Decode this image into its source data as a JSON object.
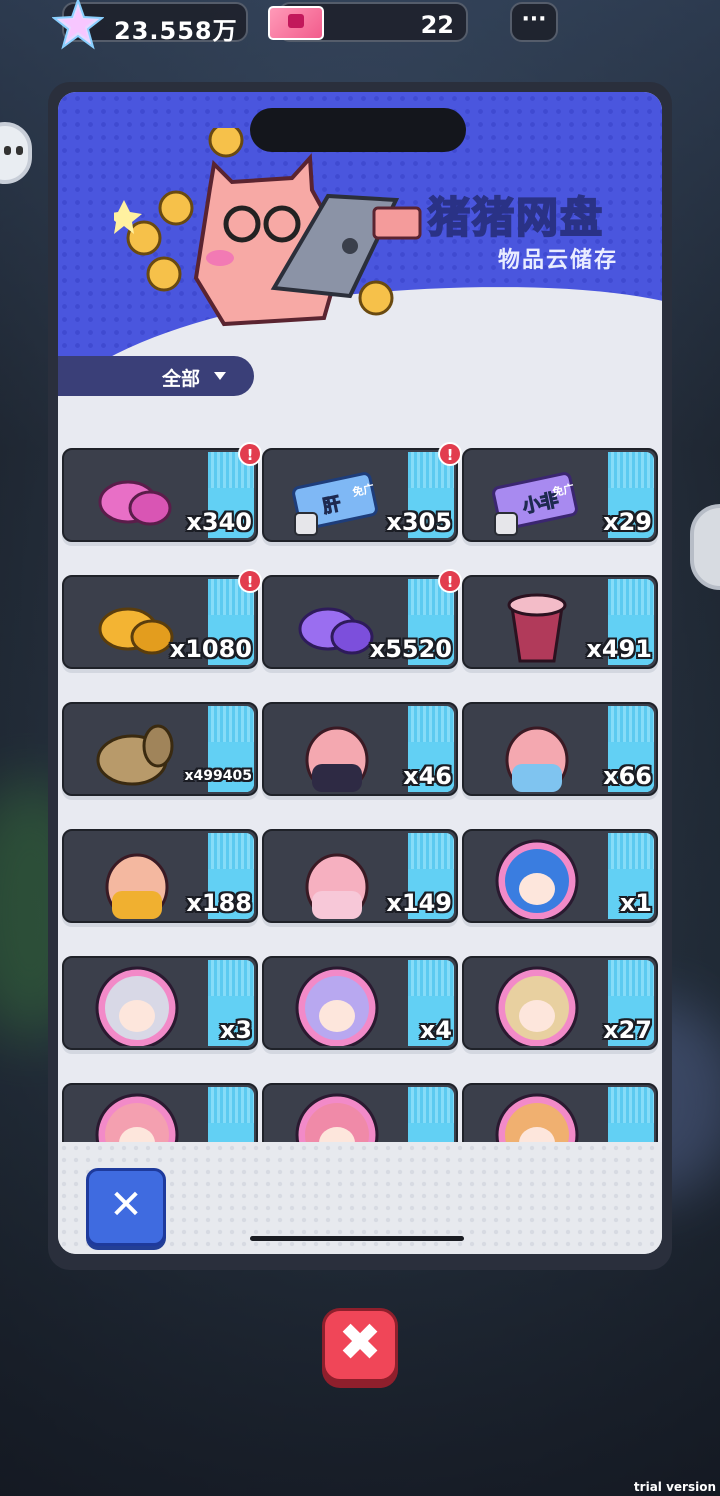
{
  "topbar": {
    "currency_value": "23.558万",
    "ticket_value": "22",
    "more_label": "···"
  },
  "modal": {
    "title": "猪猪网盘",
    "subtitle": "物品云储存",
    "filter_label": "全部",
    "close_label": "✕"
  },
  "items": [
    {
      "count": "x340",
      "alert": true,
      "puzzle": false,
      "icon": "pink-pebbles-icon"
    },
    {
      "count": "x305",
      "alert": true,
      "puzzle": true,
      "icon": "blue-ticket-icon",
      "ticket_text": "肝",
      "ticket_sub": "免广"
    },
    {
      "count": "x29",
      "alert": false,
      "puzzle": true,
      "icon": "purple-ticket-icon",
      "ticket_text": "小非",
      "ticket_sub": "免广"
    },
    {
      "count": "x1080",
      "alert": true,
      "puzzle": false,
      "icon": "gold-pebbles-icon"
    },
    {
      "count": "x5520",
      "alert": true,
      "puzzle": false,
      "icon": "purple-pebbles-icon"
    },
    {
      "count": "x491",
      "alert": false,
      "puzzle": false,
      "icon": "bubble-tea-icon"
    },
    {
      "count": "x499405",
      "alert": false,
      "puzzle": false,
      "icon": "snail-icon"
    },
    {
      "count": "x46",
      "alert": false,
      "puzzle": false,
      "icon": "pig-suit-icon"
    },
    {
      "count": "x66",
      "alert": false,
      "puzzle": false,
      "icon": "pig-blue-icon"
    },
    {
      "count": "x188",
      "alert": false,
      "puzzle": false,
      "icon": "pig-yellow-icon"
    },
    {
      "count": "x149",
      "alert": false,
      "puzzle": false,
      "icon": "pig-pink-icon"
    },
    {
      "count": "x1",
      "alert": false,
      "puzzle": false,
      "icon": "avatar-blue-hair-icon"
    },
    {
      "count": "x3",
      "alert": false,
      "puzzle": false,
      "icon": "avatar-silver-hair-icon"
    },
    {
      "count": "x4",
      "alert": false,
      "puzzle": false,
      "icon": "avatar-lilac-hair-icon"
    },
    {
      "count": "x27",
      "alert": false,
      "puzzle": false,
      "icon": "avatar-blonde-hair-icon"
    },
    {
      "count": "",
      "alert": false,
      "puzzle": false,
      "icon": "avatar-pink-hair-icon"
    },
    {
      "count": "",
      "alert": false,
      "puzzle": false,
      "icon": "avatar-pink-hair-2-icon"
    },
    {
      "count": "",
      "alert": false,
      "puzzle": false,
      "icon": "avatar-orange-hair-icon"
    }
  ],
  "bottom": {
    "close_label": "✖"
  },
  "watermark": "trial version",
  "colors": {
    "accent_blue": "#4a56de",
    "title_green": "#7ef0b4",
    "close_red": "#f04658",
    "stripe_cyan": "#5ccaf0"
  }
}
